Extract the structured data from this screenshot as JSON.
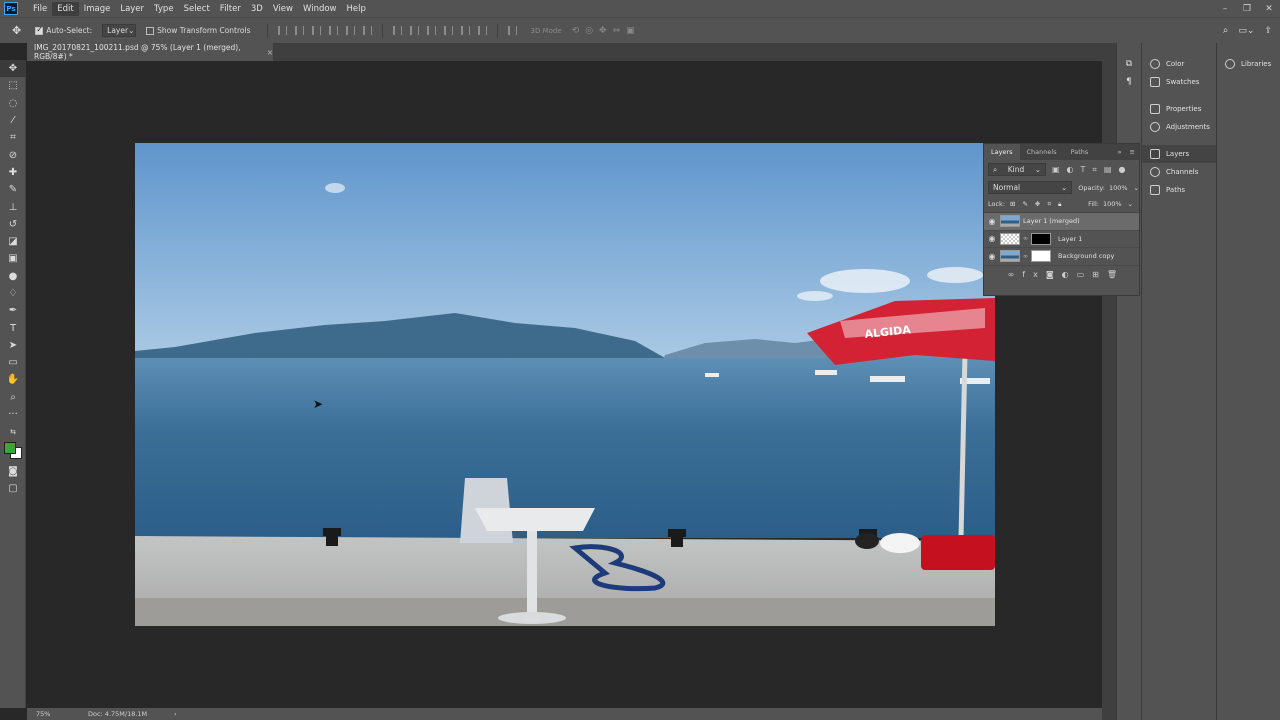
{
  "app": {
    "logo": "Ps"
  },
  "menu": [
    "File",
    "Edit",
    "Image",
    "Layer",
    "Type",
    "Select",
    "Filter",
    "3D",
    "View",
    "Window",
    "Help"
  ],
  "options": {
    "auto_select_label": "Auto-Select:",
    "auto_select_value": "Layer",
    "transform_label": "Show Transform Controls",
    "mode_3d": "3D Mode"
  },
  "document": {
    "tab_title": "IMG_20170821_100211.psd @ 75% (Layer 1 (merged), RGB/8#) *",
    "close": "×"
  },
  "status": {
    "zoom": "75%",
    "doc": "Doc: 4.75M/18.1M",
    "arrow": "›"
  },
  "collapsed_panels": [
    {
      "label": "Color",
      "icon": "color-wheel-icon"
    },
    {
      "label": "Swatches",
      "icon": "swatches-grid-icon"
    },
    {
      "label": "Properties",
      "icon": "properties-icon"
    },
    {
      "label": "Adjustments",
      "icon": "adjustments-icon"
    },
    {
      "label": "Layers",
      "icon": "layers-stack-icon"
    },
    {
      "label": "Channels",
      "icon": "channels-icon"
    },
    {
      "label": "Paths",
      "icon": "paths-icon"
    }
  ],
  "libraries": {
    "label": "Libraries"
  },
  "layers_panel": {
    "tabs": [
      "Layers",
      "Channels",
      "Paths"
    ],
    "filter_kind": "Kind",
    "blend_mode": "Normal",
    "opacity_label": "Opacity:",
    "opacity_value": "100%",
    "lock_label": "Lock:",
    "fill_label": "Fill:",
    "fill_value": "100%",
    "layers": [
      {
        "name": "Layer 1 (merged)"
      },
      {
        "name": "Layer 1"
      },
      {
        "name": "Background copy"
      }
    ]
  },
  "colors": {
    "foreground": "#3aa635",
    "background": "#ffffff",
    "umbrella_text": "ALGIDA"
  }
}
